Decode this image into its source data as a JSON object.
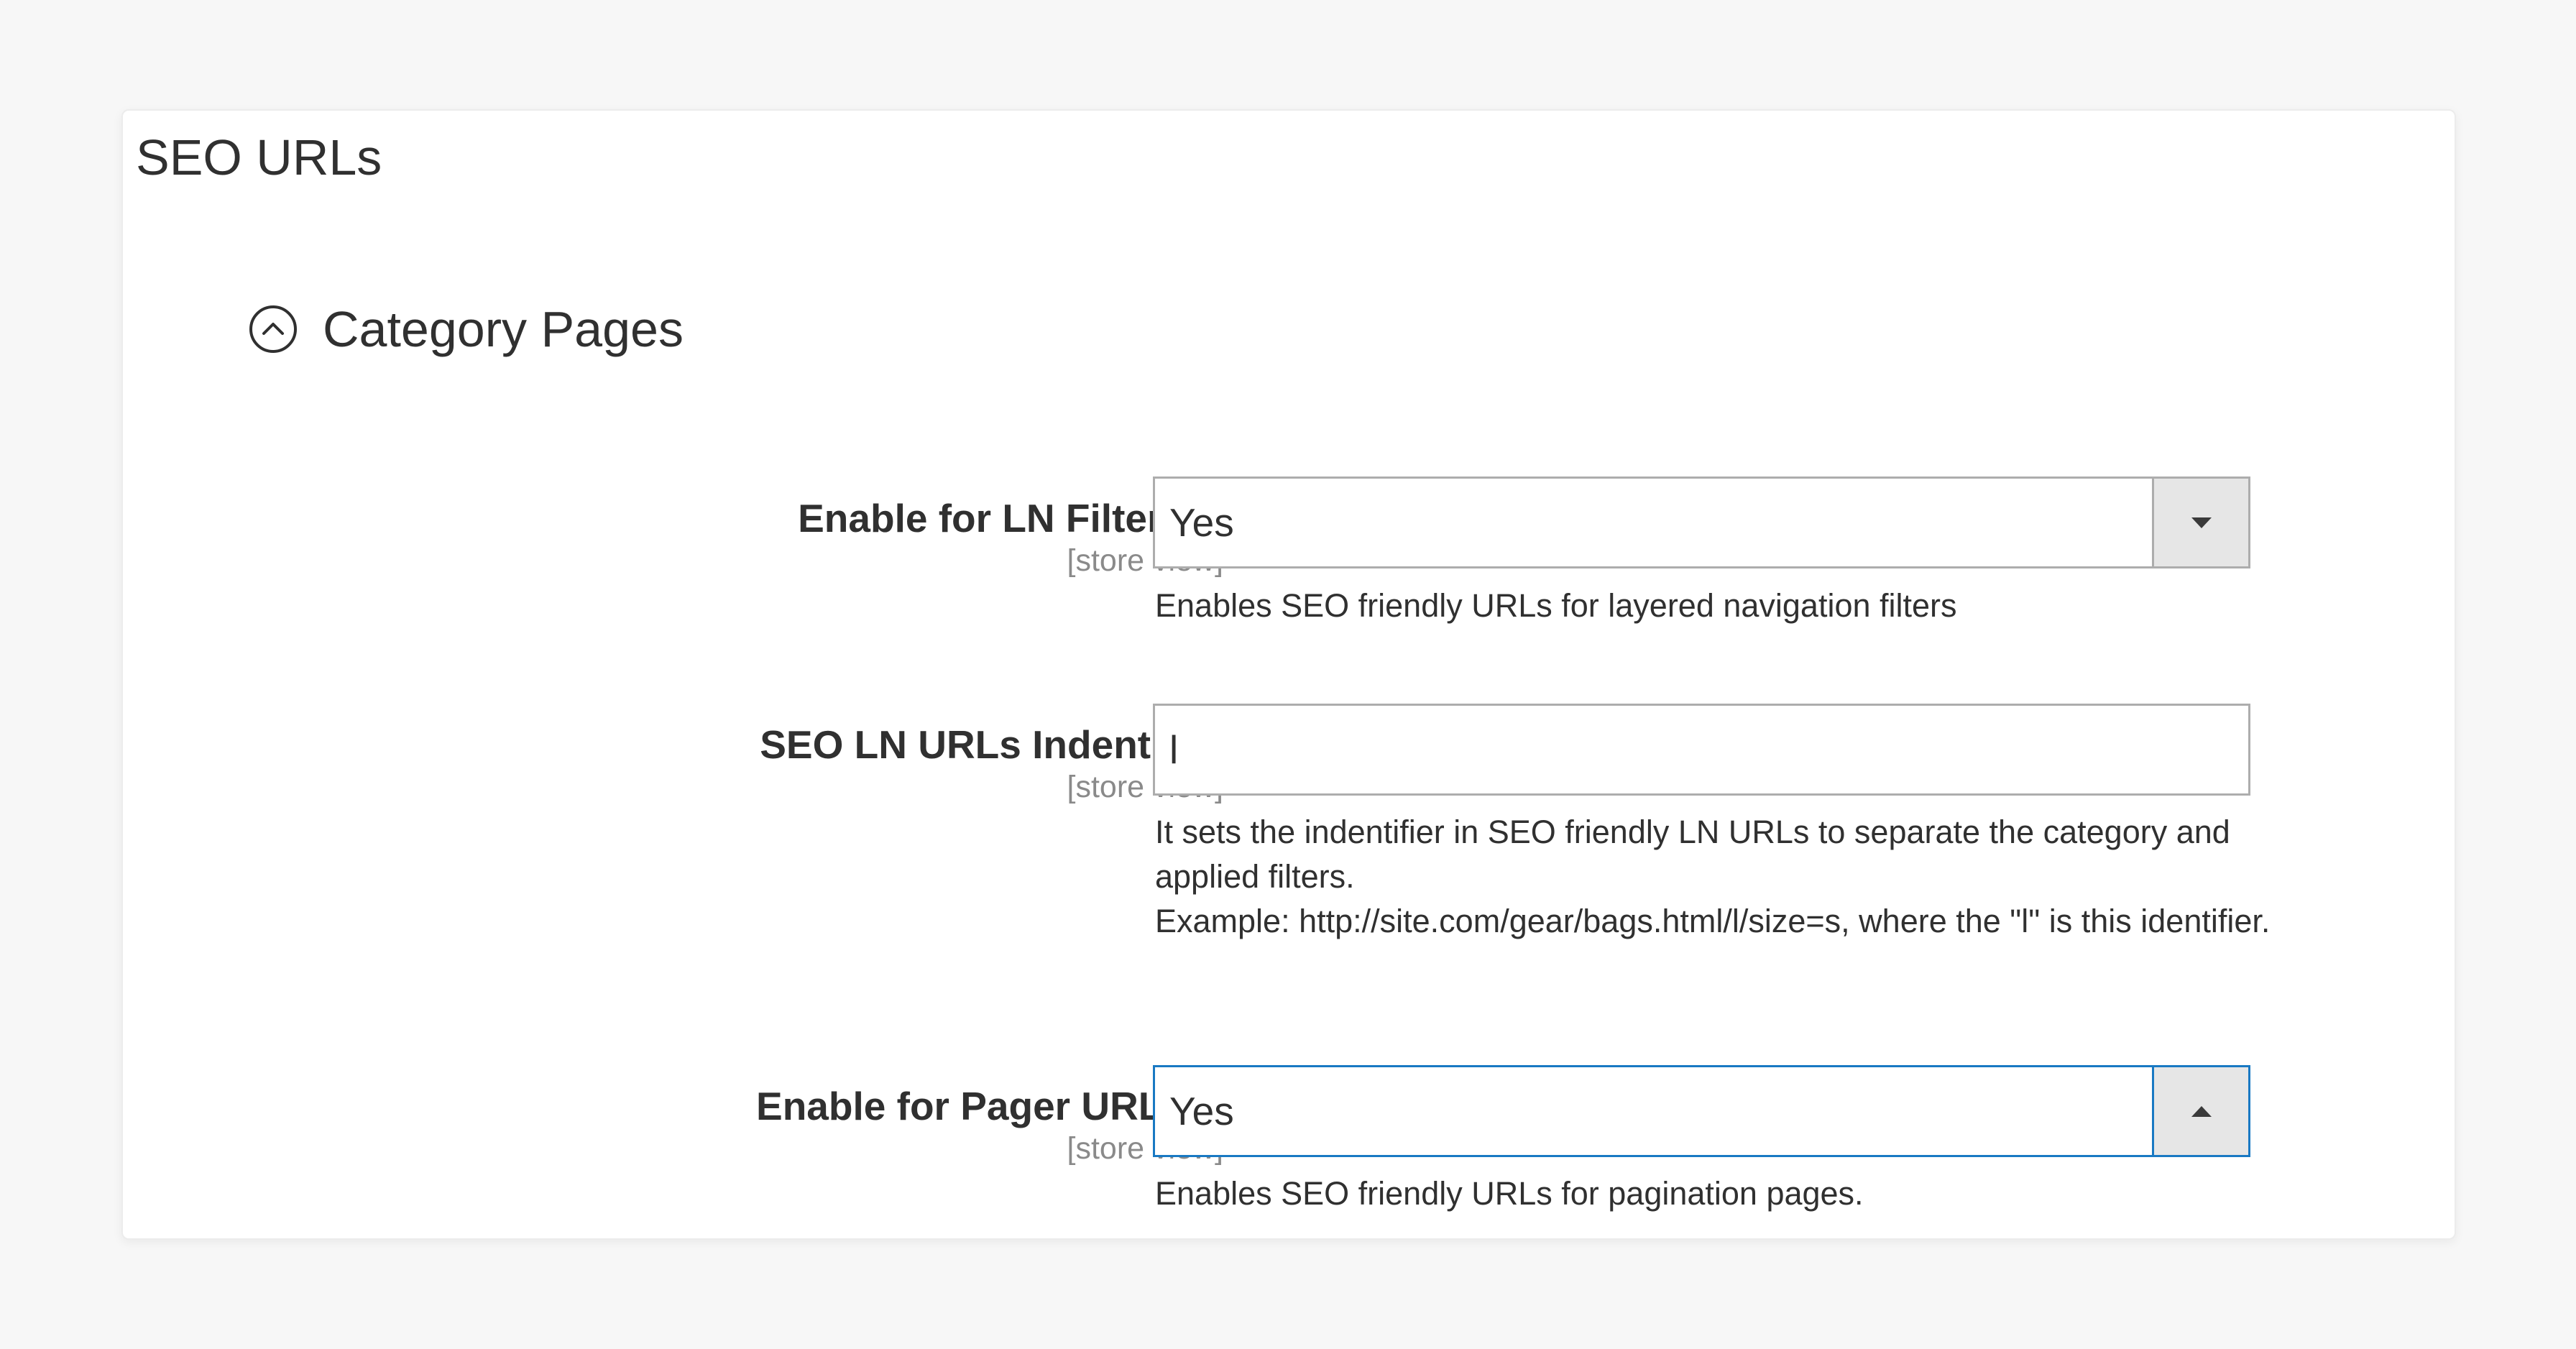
{
  "section": {
    "title": "SEO URLs"
  },
  "group": {
    "title": "Category Pages",
    "icon": "chevron-up-circle-icon"
  },
  "fields": {
    "ln_filters": {
      "label": "Enable for LN Filters",
      "scope": "[store view]",
      "value": "Yes",
      "note": "Enables SEO friendly URLs for layered navigation filters"
    },
    "ln_identifier": {
      "label": "SEO LN URLs Indentifier",
      "scope": "[store view]",
      "value": "l",
      "note_line1": "It sets the indentifier in SEO friendly LN URLs to separate the category and applied filters.",
      "note_line2": "Example: http://site.com/gear/bags.html/l/size=s, where the \"l\" is this identifier."
    },
    "pager_urls": {
      "label": "Enable for Pager URLs",
      "scope": "[store view]",
      "value": "Yes",
      "note": "Enables SEO friendly URLs for pagination pages."
    }
  },
  "colors": {
    "background": "#f7f7f7",
    "card": "#ffffff",
    "text": "#303030",
    "muted": "#8a8a8a",
    "focus_border": "#1979c3",
    "select_button": "#e6e6e6"
  }
}
